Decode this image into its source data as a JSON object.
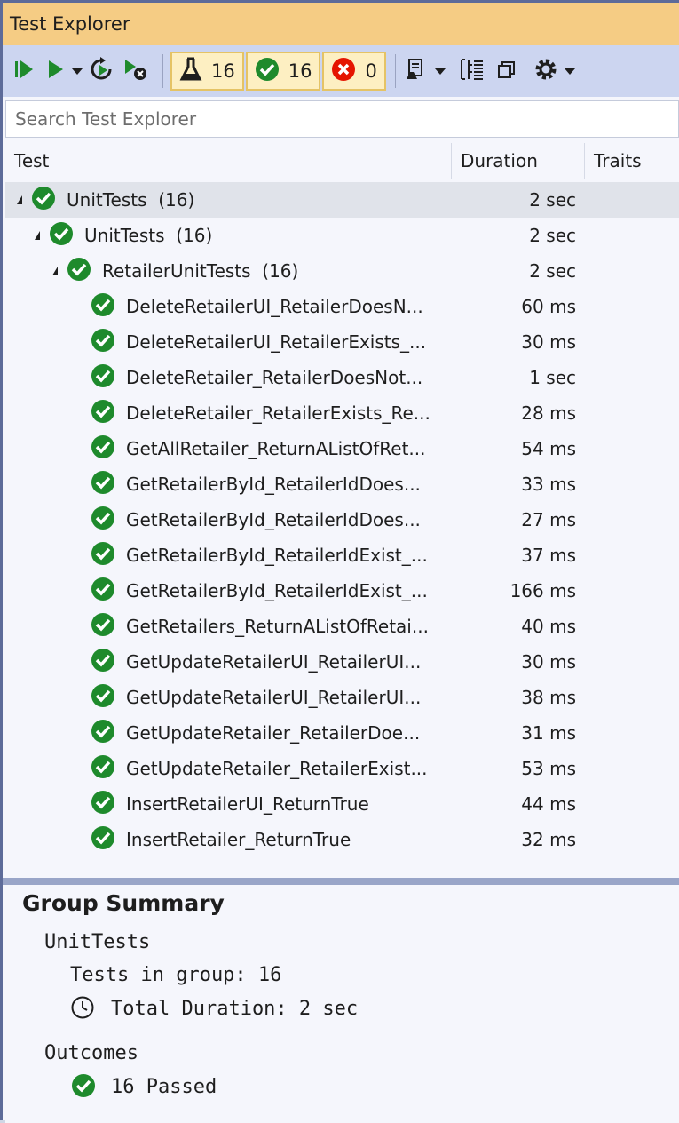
{
  "window": {
    "title": "Test Explorer"
  },
  "toolbar": {
    "total_count": "16",
    "passed_count": "16",
    "failed_count": "0"
  },
  "search": {
    "placeholder": "Search Test Explorer"
  },
  "columns": {
    "test": "Test",
    "duration": "Duration",
    "traits": "Traits"
  },
  "tree": {
    "root": {
      "name": "UnitTests",
      "count": "(16)",
      "duration": "2 sec"
    },
    "namespace": {
      "name": "UnitTests",
      "count": "(16)",
      "duration": "2 sec"
    },
    "class": {
      "name": "RetailerUnitTests",
      "count": "(16)",
      "duration": "2 sec"
    },
    "tests": [
      {
        "name": "DeleteRetailerUI_RetailerDoesN...",
        "duration": "60 ms"
      },
      {
        "name": "DeleteRetailerUI_RetailerExists_...",
        "duration": "30 ms"
      },
      {
        "name": "DeleteRetailer_RetailerDoesNot...",
        "duration": "1 sec"
      },
      {
        "name": "DeleteRetailer_RetailerExists_Re...",
        "duration": "28 ms"
      },
      {
        "name": "GetAllRetailer_ReturnAListOfRet...",
        "duration": "54 ms"
      },
      {
        "name": "GetRetailerById_RetailerIdDoes...",
        "duration": "33 ms"
      },
      {
        "name": "GetRetailerById_RetailerIdDoes...",
        "duration": "27 ms"
      },
      {
        "name": "GetRetailerById_RetailerIdExist_...",
        "duration": "37 ms"
      },
      {
        "name": "GetRetailerById_RetailerIdExist_...",
        "duration": "166 ms"
      },
      {
        "name": "GetRetailers_ReturnAListOfRetai...",
        "duration": "40 ms"
      },
      {
        "name": "GetUpdateRetailerUI_RetailerUI...",
        "duration": "30 ms"
      },
      {
        "name": "GetUpdateRetailerUI_RetailerUI...",
        "duration": "38 ms"
      },
      {
        "name": "GetUpdateRetailer_RetailerDoe...",
        "duration": "31 ms"
      },
      {
        "name": "GetUpdateRetailer_RetailerExist...",
        "duration": "53 ms"
      },
      {
        "name": "InsertRetailerUI_ReturnTrue",
        "duration": "44 ms"
      },
      {
        "name": "InsertRetailer_ReturnTrue",
        "duration": "32 ms"
      }
    ]
  },
  "summary": {
    "title": "Group Summary",
    "group_name": "UnitTests",
    "tests_in_group": "Tests in group: 16",
    "total_duration": "Total Duration: 2 sec",
    "outcomes_label": "Outcomes",
    "passed": "16 Passed"
  },
  "colors": {
    "accent": "#f5cc84",
    "pass": "#1e8a2c",
    "fail": "#e51400"
  }
}
